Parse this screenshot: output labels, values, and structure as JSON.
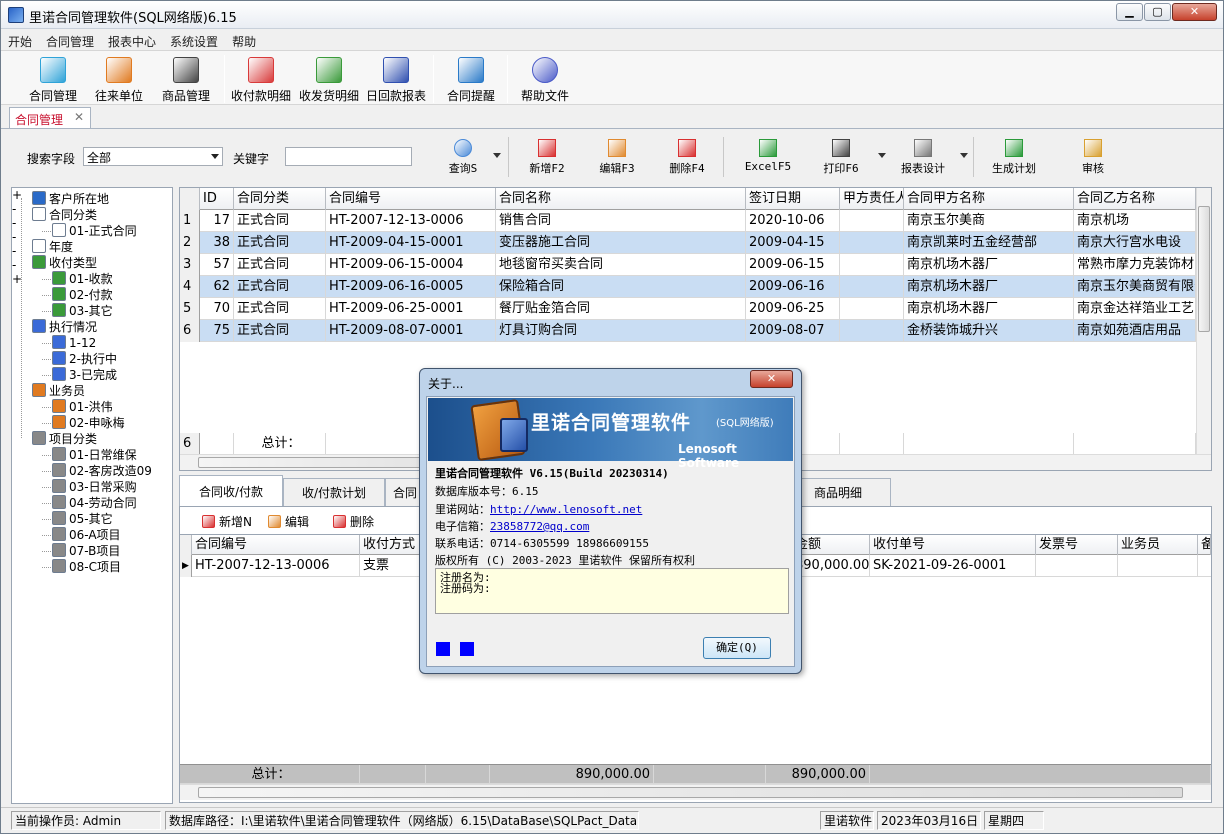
{
  "window": {
    "title": "里诺合同管理软件(SQL网络版)6.15",
    "min": "▁",
    "max": "▢",
    "close": "✕"
  },
  "menu": [
    "开始",
    "合同管理",
    "报表中心",
    "系统设置",
    "帮助"
  ],
  "toolbar": [
    {
      "label": "合同管理",
      "icon": "contract-icon",
      "color": "#2fa3d8"
    },
    {
      "label": "往来单位",
      "icon": "partner-icon",
      "color": "#e07a20"
    },
    {
      "label": "商品管理",
      "icon": "goods-icon",
      "color": "#444444"
    },
    {
      "label": "收付款明细",
      "icon": "payment-detail-icon",
      "color": "#d83a3a"
    },
    {
      "label": "收发货明细",
      "icon": "shipping-detail-icon",
      "color": "#3a9a3a"
    },
    {
      "label": "日回款报表",
      "icon": "daily-report-icon",
      "color": "#3050b0"
    },
    {
      "label": "合同提醒",
      "icon": "reminder-icon",
      "color": "#2a7ac8"
    },
    {
      "label": "帮助文件",
      "icon": "help-icon",
      "color": "#4a5ac8"
    }
  ],
  "doc_tab": {
    "label": "合同管理",
    "close": "✕"
  },
  "search": {
    "field_label": "搜索字段",
    "field_value": "全部",
    "keyword_label": "关键字",
    "keyword_value": ""
  },
  "actions": [
    {
      "label": "查询S",
      "icon": "search-icon",
      "color": "#4a8ad8"
    },
    {
      "label": "新增F2",
      "icon": "add-icon",
      "color": "#d83030"
    },
    {
      "label": "编辑F3",
      "icon": "edit-icon",
      "color": "#e08a30"
    },
    {
      "label": "删除F4",
      "icon": "delete-icon",
      "color": "#d83030"
    },
    {
      "label": "ExcelF5",
      "icon": "excel-icon",
      "color": "#2a9a3a"
    },
    {
      "label": "打印F6",
      "icon": "print-icon",
      "color": "#444444"
    },
    {
      "label": "报表设计",
      "icon": "report-design-icon",
      "color": "#777777"
    },
    {
      "label": "生成计划",
      "icon": "plan-icon",
      "color": "#2a9a3a"
    },
    {
      "label": "审核",
      "icon": "audit-icon",
      "color": "#d8a030"
    }
  ],
  "tree": [
    {
      "label": "客户所在地",
      "level": 0,
      "icon": "globe-icon",
      "color": "#2a6ac8",
      "exp": "+"
    },
    {
      "label": "合同分类",
      "level": 0,
      "icon": "document-icon",
      "color": "#ffffff",
      "exp": "-"
    },
    {
      "label": "01-正式合同",
      "level": 1,
      "icon": "document-icon",
      "color": "#ffffff"
    },
    {
      "label": "年度",
      "level": 0,
      "icon": "clock-icon",
      "color": "#ffffff",
      "exp": ""
    },
    {
      "label": "收付类型",
      "level": 0,
      "icon": "payment-type-icon",
      "color": "#3a9a3a",
      "exp": "-"
    },
    {
      "label": "01-收款",
      "level": 1,
      "icon": "payment-type-icon",
      "color": "#3a9a3a"
    },
    {
      "label": "02-付款",
      "level": 1,
      "icon": "payment-type-icon",
      "color": "#3a9a3a"
    },
    {
      "label": "03-其它",
      "level": 1,
      "icon": "payment-type-icon",
      "color": "#3a9a3a"
    },
    {
      "label": "执行情况",
      "level": 0,
      "icon": "status-icon",
      "color": "#3a6ad8",
      "exp": "-"
    },
    {
      "label": "1-12",
      "level": 1,
      "icon": "status-icon",
      "color": "#3a6ad8"
    },
    {
      "label": "2-执行中",
      "level": 1,
      "icon": "status-icon",
      "color": "#3a6ad8"
    },
    {
      "label": "3-已完成",
      "level": 1,
      "icon": "status-icon",
      "color": "#3a6ad8"
    },
    {
      "label": "业务员",
      "level": 0,
      "icon": "salesman-icon",
      "color": "#e07a20",
      "exp": "-"
    },
    {
      "label": "01-洪伟",
      "level": 1,
      "icon": "salesman-icon",
      "color": "#e07a20"
    },
    {
      "label": "02-申咏梅",
      "level": 1,
      "icon": "salesman-icon",
      "color": "#e07a20"
    },
    {
      "label": "项目分类",
      "level": 0,
      "icon": "project-icon",
      "color": "#888888",
      "exp": "-"
    },
    {
      "label": "01-日常维保",
      "level": 1,
      "icon": "project-icon",
      "color": "#888888"
    },
    {
      "label": "02-客房改造09",
      "level": 1,
      "icon": "project-icon",
      "color": "#888888",
      "exp": "+"
    },
    {
      "label": "03-日常采购",
      "level": 1,
      "icon": "project-icon",
      "color": "#888888"
    },
    {
      "label": "04-劳动合同",
      "level": 1,
      "icon": "project-icon",
      "color": "#888888"
    },
    {
      "label": "05-其它",
      "level": 1,
      "icon": "project-icon",
      "color": "#888888"
    },
    {
      "label": "06-A项目",
      "level": 1,
      "icon": "project-icon",
      "color": "#888888"
    },
    {
      "label": "07-B项目",
      "level": 1,
      "icon": "project-icon",
      "color": "#888888"
    },
    {
      "label": "08-C项目",
      "level": 1,
      "icon": "project-icon",
      "color": "#888888"
    }
  ],
  "main_grid": {
    "columns": [
      "ID",
      "合同分类",
      "合同编号",
      "合同名称",
      "签订日期",
      "甲方责任人",
      "合同甲方名称",
      "合同乙方名称"
    ],
    "rows": [
      {
        "no": "1",
        "id": "17",
        "type": "正式合同",
        "code": "HT-2007-12-13-0006",
        "name": "销售合同",
        "date": "2020-10-06",
        "person": "",
        "party_a": "南京玉尔美商",
        "party_b": "南京机场"
      },
      {
        "no": "2",
        "id": "38",
        "type": "正式合同",
        "code": "HT-2009-04-15-0001",
        "name": "变压器施工合同",
        "date": "2009-04-15",
        "person": "",
        "party_a": "南京凯莱时五金经营部",
        "party_b": "南京大行宫水电设"
      },
      {
        "no": "3",
        "id": "57",
        "type": "正式合同",
        "code": "HT-2009-06-15-0004",
        "name": "地毯窗帘买卖合同",
        "date": "2009-06-15",
        "person": "",
        "party_a": "南京机场木器厂",
        "party_b": "常熟市摩力克装饰材"
      },
      {
        "no": "4",
        "id": "62",
        "type": "正式合同",
        "code": "HT-2009-06-16-0005",
        "name": "保险箱合同",
        "date": "2009-06-16",
        "person": "",
        "party_a": "南京机场木器厂",
        "party_b": "南京玉尔美商贸有限公"
      },
      {
        "no": "5",
        "id": "70",
        "type": "正式合同",
        "code": "HT-2009-06-25-0001",
        "name": "餐厅贴金箔合同",
        "date": "2009-06-25",
        "person": "",
        "party_a": "南京机场木器厂",
        "party_b": "南京金达祥箔业工艺品"
      },
      {
        "no": "6",
        "id": "75",
        "type": "正式合同",
        "code": "HT-2009-08-07-0001",
        "name": "灯具订购合同",
        "date": "2009-08-07",
        "person": "",
        "party_a": "金桥装饰城升兴",
        "party_b": "南京如苑酒店用品"
      }
    ],
    "footer_count": "6",
    "footer_label": "总计："
  },
  "sub_tabs": [
    "合同收/付款",
    "收/付款计划",
    "合同",
    "商品明细"
  ],
  "sub_actions": [
    {
      "label": "新增N",
      "icon": "add-icon",
      "color": "#d83030"
    },
    {
      "label": "编辑",
      "icon": "edit-icon",
      "color": "#e08a30"
    },
    {
      "label": "删除",
      "icon": "delete-icon",
      "color": "#d83030"
    }
  ],
  "sub_grid": {
    "columns": [
      "合同编号",
      "收付方式",
      "金额",
      "收付单号",
      "发票号",
      "业务员",
      "备"
    ],
    "row": {
      "code": "HT-2007-12-13-0006",
      "method": "支票",
      "amount": "890,000.00",
      "number": "SK-2021-09-26-0001",
      "invoice": "",
      "salesman": ""
    },
    "footer_label": "总计：",
    "footer_amount1": "890,000.00",
    "footer_amount2": "890,000.00"
  },
  "statusbar": {
    "operator": "当前操作员: Admin",
    "db_path": "数据库路径：I:\\里诺软件\\里诺合同管理软件（网络版）6.15\\DataBase\\SQLPact_Data.M",
    "company": "里诺软件",
    "date": "2023年03月16日",
    "weekday": "星期四"
  },
  "about_dialog": {
    "title": "关于...",
    "close": "✕",
    "banner_title": "里诺合同管理软件",
    "banner_edition": "(SQL网络版)",
    "banner_company": "Lenosoft Software",
    "version": "里诺合同管理软件 V6.15(Build 20230314)",
    "db_version": "数据库版本号：6.15",
    "website_label": "里诺网站：",
    "website": "http://www.lenosoft.net",
    "email_label": "电子信箱：",
    "email": "23858772@qq.com",
    "phone": "联系电话：0714-6305599  18986609155",
    "copyright": "版权所有 (C) 2003-2023 里诺软件 保留所有权利",
    "reg_name": "注册名为:",
    "reg_code": "注册码为:",
    "ok": "确定(Q)"
  }
}
